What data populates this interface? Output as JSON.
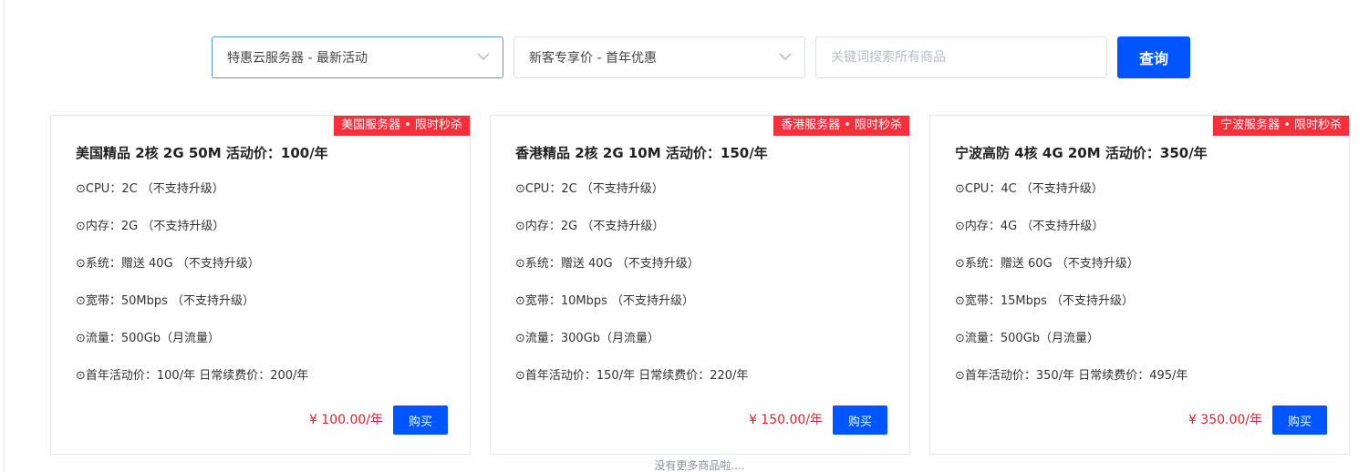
{
  "filters": {
    "category": "特惠云服务器 - 最新活动",
    "promo": "新客专享价 - 首年优惠",
    "search_placeholder": "关键词搜索所有商品",
    "query_label": "查询"
  },
  "products": [
    {
      "tag": "美国服务器 • 限时秒杀",
      "title": "美国精品 2核 2G 50M 活动价：100/年",
      "specs": [
        "⊙CPU：2C （不支持升级）",
        "⊙内存：2G （不支持升级）",
        "⊙系统：赠送 40G （不支持升级）",
        "⊙宽带：50Mbps （不支持升级）",
        "⊙流量：500Gb（月流量）",
        "⊙首年活动价：100/年 日常续费价：200/年"
      ],
      "price": "¥ 100.00/年",
      "buy_label": "购买"
    },
    {
      "tag": "香港服务器 • 限时秒杀",
      "title": "香港精品 2核 2G 10M 活动价：150/年",
      "specs": [
        "⊙CPU：2C （不支持升级）",
        "⊙内存：2G （不支持升级）",
        "⊙系统：赠送 40G （不支持升级）",
        "⊙宽带：10Mbps （不支持升级）",
        "⊙流量：300Gb（月流量）",
        "⊙首年活动价：150/年 日常续费价：220/年"
      ],
      "price": "¥ 150.00/年",
      "buy_label": "购买"
    },
    {
      "tag": "宁波服务器 • 限时秒杀",
      "title": "宁波高防 4核 4G 20M 活动价：350/年",
      "specs": [
        "⊙CPU：4C （不支持升级）",
        "⊙内存：4G （不支持升级）",
        "⊙系统：赠送 60G （不支持升级）",
        "⊙宽带：15Mbps （不支持升级）",
        "⊙流量：500Gb（月流量）",
        "⊙首年活动价：350/年 日常续费价：495/年"
      ],
      "price": "¥ 350.00/年",
      "buy_label": "购买"
    }
  ],
  "footer": {
    "no_more": "没有更多商品啦...."
  },
  "colors": {
    "primary": "#0055ff",
    "tag_red": "#f5303a",
    "price_red": "#e5202a"
  },
  "icons": {
    "dropdown": "chevron-down-icon"
  }
}
